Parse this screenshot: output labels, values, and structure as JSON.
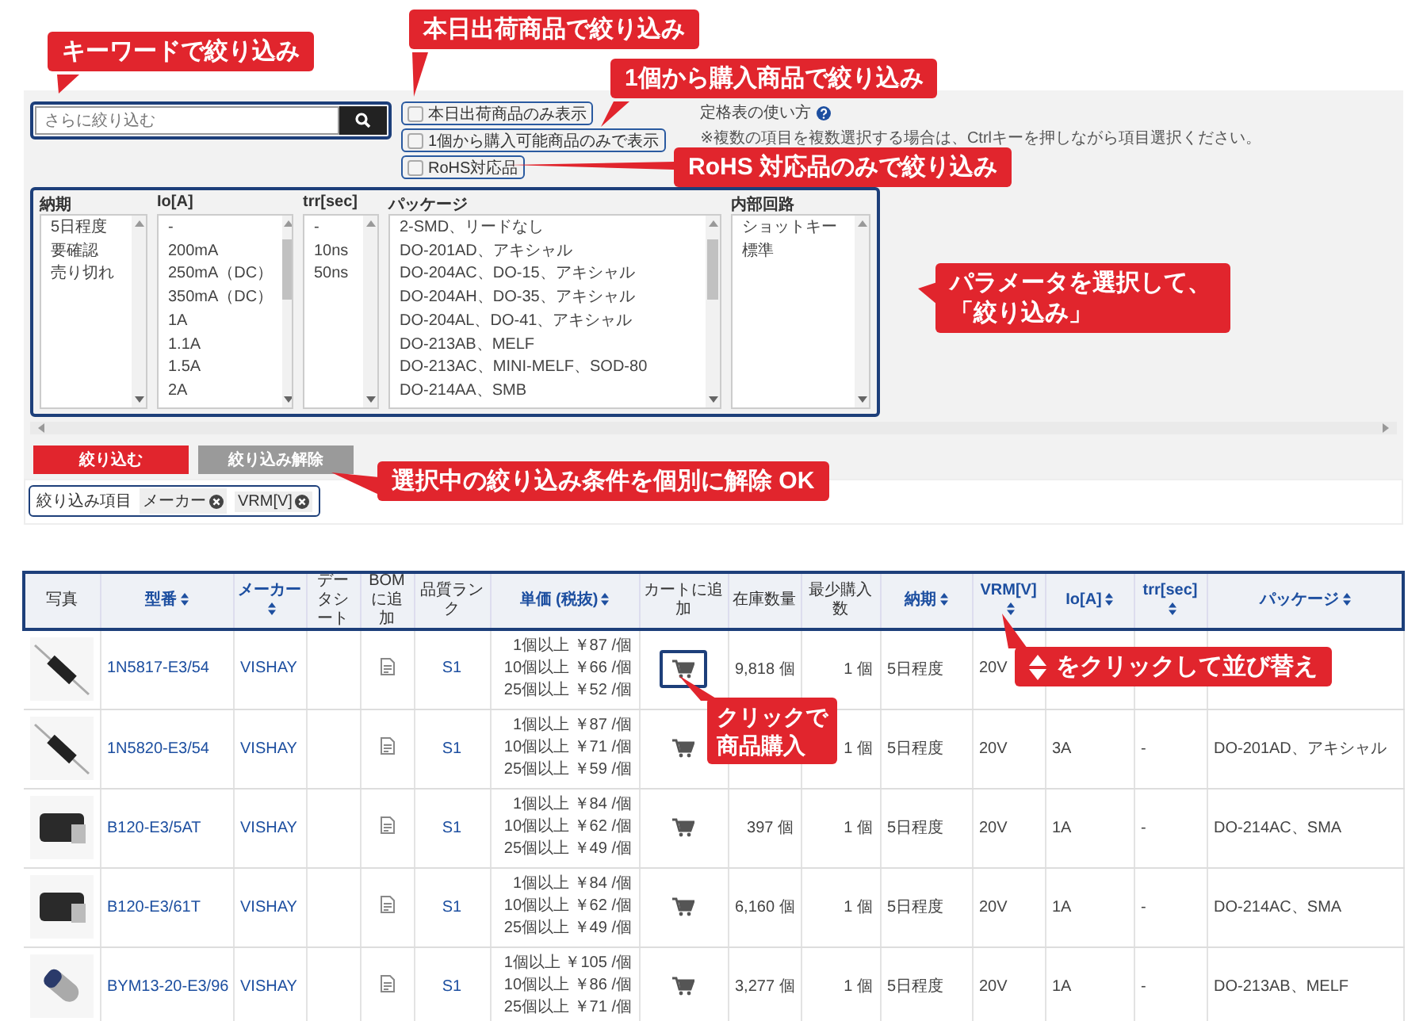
{
  "search": {
    "placeholder": "さらに絞り込む"
  },
  "checkboxes": [
    {
      "label": "本日出荷商品のみ表示",
      "checked": false
    },
    {
      "label": "1個から購入可能商品のみで表示",
      "checked": false
    },
    {
      "label": "RoHS対応品",
      "checked": false
    }
  ],
  "help": {
    "title": "定格表の使い方",
    "note": "※複数の項目を複数選択する場合は、Ctrlキーを押しながら項目選択ください。"
  },
  "filters": [
    {
      "label": "納期",
      "items": [
        "5日程度",
        "要確認",
        "売り切れ"
      ]
    },
    {
      "label": "Io[A]",
      "items": [
        "-",
        "200mA",
        "250mA（DC）",
        "350mA（DC）",
        "1A",
        "1.1A",
        "1.5A",
        "2A"
      ]
    },
    {
      "label": "trr[sec]",
      "items": [
        "-",
        "10ns",
        "50ns"
      ]
    },
    {
      "label": "パッケージ",
      "items": [
        "2-SMD、リードなし",
        "DO-201AD、アキシャル",
        "DO-204AC、DO-15、アキシャル",
        "DO-204AH、DO-35、アキシャル",
        "DO-204AL、DO-41、アキシャル",
        "DO-213AB、MELF",
        "DO-213AC、MINI-MELF、SOD-80",
        "DO-214AA、SMB"
      ]
    },
    {
      "label": "内部回路",
      "items": [
        "ショットキー",
        "標準"
      ]
    }
  ],
  "buttons": [
    {
      "label": "絞り込む",
      "kind": "primary"
    },
    {
      "label": "絞り込み解除",
      "kind": "secondary"
    }
  ],
  "active_filters": {
    "label": "絞り込み項目",
    "chips": [
      "メーカー",
      "VRM[V]"
    ]
  },
  "table": {
    "columns": [
      {
        "label": "写真",
        "sortable": false
      },
      {
        "label": "型番",
        "sortable": true
      },
      {
        "label": "メーカー",
        "sortable": true
      },
      {
        "label": "データシート",
        "sortable": false
      },
      {
        "label": "BOMに追加",
        "sortable": false
      },
      {
        "label": "品質ランク",
        "sortable": false
      },
      {
        "label": "単価 (税抜)",
        "sortable": true
      },
      {
        "label": "カートに追加",
        "sortable": false
      },
      {
        "label": "在庫数量",
        "sortable": false
      },
      {
        "label": "最少購入数",
        "sortable": false
      },
      {
        "label": "納期",
        "sortable": true
      },
      {
        "label": "VRM[V]",
        "sortable": true
      },
      {
        "label": "Io[A]",
        "sortable": true
      },
      {
        "label": "trr[sec]",
        "sortable": true
      },
      {
        "label": "パッケージ",
        "sortable": true
      }
    ],
    "rows": [
      {
        "kind": "axial",
        "part": "1N5817-E3/54",
        "maker": "VISHAY",
        "rank": "S1",
        "prices": [
          "1個以上 ￥87 /個",
          "10個以上 ￥66 /個",
          "25個以上 ￥52 /個"
        ],
        "cart_highlighted": true,
        "stock": "9,818 個",
        "min": "1 個",
        "delivery": "5日程度",
        "vrm": "20V"
      },
      {
        "kind": "axial",
        "part": "1N5820-E3/54",
        "maker": "VISHAY",
        "rank": "S1",
        "prices": [
          "1個以上 ￥87 /個",
          "10個以上 ￥71 /個",
          "25個以上 ￥59 /個"
        ],
        "cart_highlighted": false,
        "min": "1 個",
        "delivery": "5日程度",
        "vrm": "20V",
        "io": "3A",
        "trr": "-",
        "package": "DO-201AD、アキシャル"
      },
      {
        "kind": "smd",
        "part": "B120-E3/5AT",
        "maker": "VISHAY",
        "rank": "S1",
        "prices": [
          "1個以上 ￥84 /個",
          "10個以上 ￥62 /個",
          "25個以上 ￥49 /個"
        ],
        "cart_highlighted": false,
        "stock": "397 個",
        "min": "1 個",
        "delivery": "5日程度",
        "vrm": "20V",
        "io": "1A",
        "trr": "-",
        "package": "DO-214AC、SMA"
      },
      {
        "kind": "smd",
        "part": "B120-E3/61T",
        "maker": "VISHAY",
        "rank": "S1",
        "prices": [
          "1個以上 ￥84 /個",
          "10個以上 ￥62 /個",
          "25個以上 ￥49 /個"
        ],
        "cart_highlighted": false,
        "stock": "6,160 個",
        "min": "1 個",
        "delivery": "5日程度",
        "vrm": "20V",
        "io": "1A",
        "trr": "-",
        "package": "DO-214AC、SMA"
      },
      {
        "kind": "melf",
        "part": "BYM13-20-E3/96",
        "maker": "VISHAY",
        "rank": "S1",
        "prices": [
          "1個以上 ￥105 /個",
          "10個以上 ￥86 /個",
          "25個以上 ￥71 /個"
        ],
        "cart_highlighted": false,
        "stock": "3,277 個",
        "min": "1 個",
        "delivery": "5日程度",
        "vrm": "20V",
        "io": "1A",
        "trr": "-",
        "package": "DO-213AB、MELF"
      }
    ]
  },
  "callouts": [
    {
      "kind": "keyword",
      "text": "キーワードで絞り込み"
    },
    {
      "kind": "ship_today",
      "text": "本日出荷商品で絞り込み"
    },
    {
      "kind": "one_piece",
      "text": "1個から購入商品で絞り込み"
    },
    {
      "kind": "rohs",
      "text": "RoHS 対応品のみで絞り込み"
    },
    {
      "kind": "params",
      "text": "パラメータを選択して、「絞り込み」"
    },
    {
      "kind": "chips",
      "text": "選択中の絞り込み条件を個別に解除 OK"
    },
    {
      "kind": "sort",
      "text": "をクリックして並び替え"
    },
    {
      "kind": "cart",
      "text": "クリックで商品購入"
    }
  ]
}
